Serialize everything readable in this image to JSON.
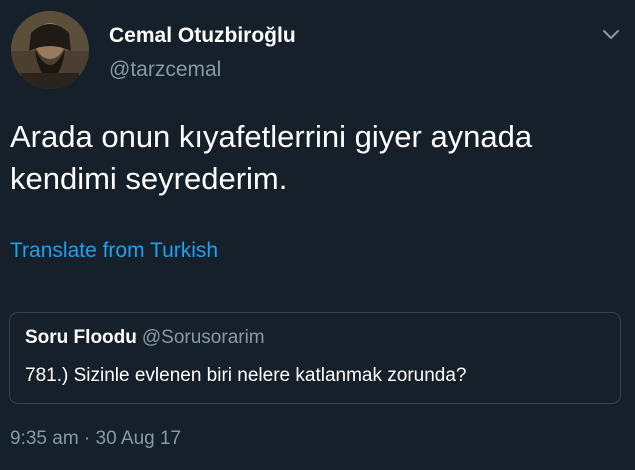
{
  "author": {
    "display_name": "Cemal Otuzbiroğlu",
    "handle": "@tarzcemal",
    "avatar_icon": "profile-photo"
  },
  "tweet": {
    "text": "Arada onun kıyafetlerrini giyer aynada kendimi seyrederim.",
    "translate_label": "Translate from Turkish",
    "timestamp": "9:35 am · 30 Aug 17"
  },
  "quoted_tweet": {
    "display_name": "Soru Floodu",
    "handle": "@Sorusorarim",
    "text": "781.) Sizinle evlenen biri nelere katlanmak zorunda?"
  },
  "menu": {
    "icon": "chevron-down-icon"
  },
  "colors": {
    "background": "#15202b",
    "primary_text": "#ffffff",
    "secondary_text": "#8899a6",
    "link": "#1da1f2",
    "border": "#38444d"
  }
}
